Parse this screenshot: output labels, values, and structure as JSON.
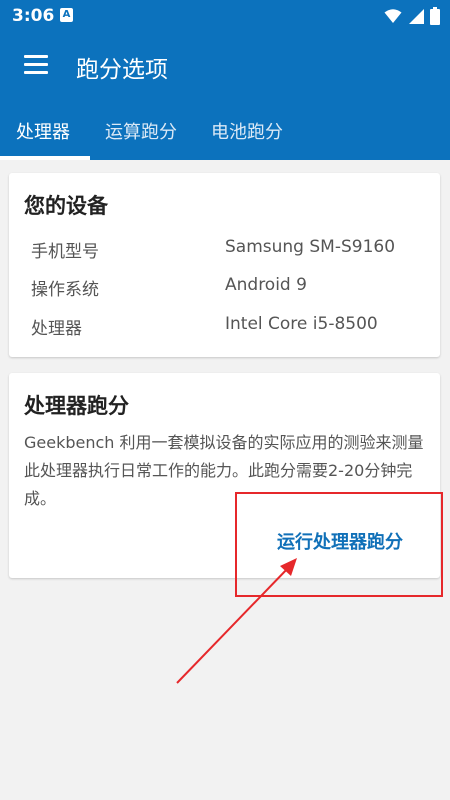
{
  "status_bar": {
    "time": "3:06",
    "notification_icon": "notification-icon",
    "icons": [
      "wifi-icon",
      "signal-icon",
      "battery-icon"
    ]
  },
  "app_bar": {
    "title": "跑分选项",
    "menu_icon": "menu-icon"
  },
  "tabs": [
    {
      "label": "处理器",
      "active": true
    },
    {
      "label": "运算跑分",
      "active": false
    },
    {
      "label": "电池跑分",
      "active": false
    }
  ],
  "device_card": {
    "title": "您的设备",
    "rows": [
      {
        "label": "手机型号",
        "value": "Samsung SM-S9160"
      },
      {
        "label": "操作系统",
        "value": "Android 9"
      },
      {
        "label": "处理器",
        "value": "Intel Core i5-8500"
      }
    ]
  },
  "cpu_card": {
    "title": "处理器跑分",
    "description": "Geekbench 利用一套模拟设备的实际应用的测验来测量此处理器执行日常工作的能力。此跑分需要2-20分钟完成。",
    "button_label": "运行处理器跑分"
  },
  "colors": {
    "primary": "#0c72bd",
    "accent_text": "#1070b8",
    "annotation_red": "#e6282b",
    "background": "#f2f2f2"
  }
}
